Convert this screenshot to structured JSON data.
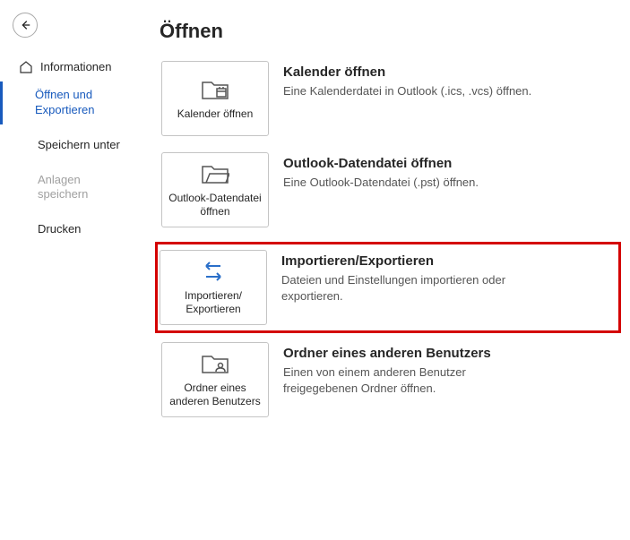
{
  "sidebar": {
    "items": [
      {
        "label": "Informationen"
      },
      {
        "label": "Öffnen und Exportieren"
      },
      {
        "label": "Speichern unter"
      },
      {
        "label": "Anlagen speichern"
      },
      {
        "label": "Drucken"
      }
    ]
  },
  "main": {
    "title": "Öffnen",
    "options": [
      {
        "tile_label": "Kalender öffnen",
        "title": "Kalender öffnen",
        "desc": "Eine Kalenderdatei in Outlook (.ics, .vcs) öffnen."
      },
      {
        "tile_label": "Outlook-Datendatei öffnen",
        "title": "Outlook-Datendatei öffnen",
        "desc": "Eine Outlook-Datendatei (.pst) öffnen."
      },
      {
        "tile_label": "Importieren/ Exportieren",
        "title": "Importieren/Exportieren",
        "desc": "Dateien und Einstellungen importieren oder exportieren."
      },
      {
        "tile_label": "Ordner eines anderen Benutzers",
        "title": "Ordner eines anderen Benutzers",
        "desc": "Einen von einem anderen Benutzer freigegebenen Ordner öffnen."
      }
    ]
  }
}
